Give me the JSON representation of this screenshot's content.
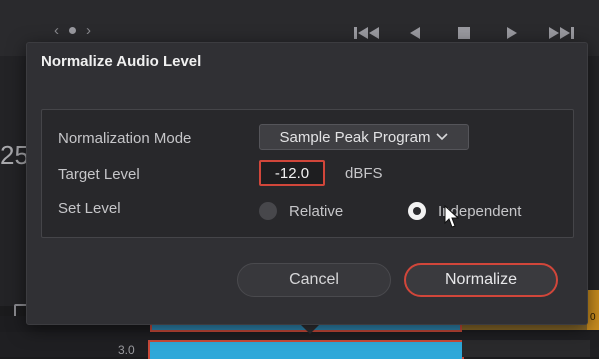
{
  "background": {
    "timecode_fragment": "25",
    "track_db_label": "3.0",
    "gold_clip_label": "0"
  },
  "dialog": {
    "title": "Normalize Audio Level",
    "normalization_mode": {
      "label": "Normalization Mode",
      "value": "Sample Peak Program",
      "icon": "chevron-down-icon"
    },
    "target_level": {
      "label": "Target Level",
      "value": "-12.0",
      "unit": "dBFS"
    },
    "set_level": {
      "label": "Set Level",
      "options": [
        {
          "label": "Relative",
          "selected": false
        },
        {
          "label": "Independent",
          "selected": true
        }
      ]
    },
    "buttons": {
      "cancel": "Cancel",
      "normalize": "Normalize"
    }
  },
  "colors": {
    "accent_red": "#d1463a",
    "clip_blue": "#2ea8d9",
    "clip_gold": "#c98d1f"
  }
}
